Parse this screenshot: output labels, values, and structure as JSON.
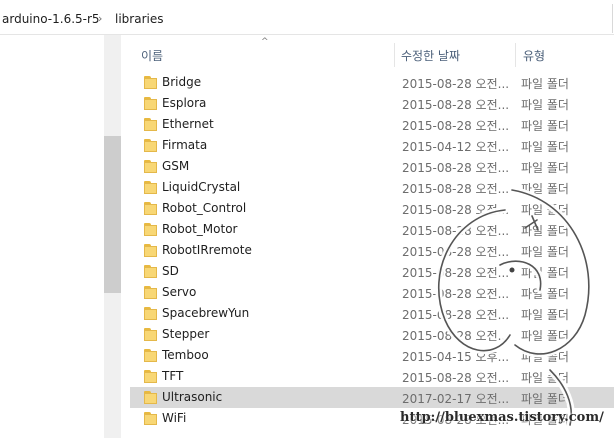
{
  "breadcrumb": {
    "parent": "arduino-1.6.5-r5",
    "separator": "›",
    "current": "libraries"
  },
  "columns": {
    "name": "이름",
    "date": "수정한 날짜",
    "type": "유형",
    "sort_indicator": "^"
  },
  "rows": [
    {
      "name": "Bridge",
      "date": "2015-08-28 오전...",
      "type": "파일 폴더",
      "icon": "folder-icon"
    },
    {
      "name": "Esplora",
      "date": "2015-08-28 오전...",
      "type": "파일 폴더",
      "icon": "folder-icon"
    },
    {
      "name": "Ethernet",
      "date": "2015-08-28 오전...",
      "type": "파일 폴더",
      "icon": "folder-icon"
    },
    {
      "name": "Firmata",
      "date": "2015-04-12 오전...",
      "type": "파일 폴더",
      "icon": "folder-icon"
    },
    {
      "name": "GSM",
      "date": "2015-08-28 오전...",
      "type": "파일 폴더",
      "icon": "folder-icon"
    },
    {
      "name": "LiquidCrystal",
      "date": "2015-08-28 오전...",
      "type": "파일 폴더",
      "icon": "folder-icon"
    },
    {
      "name": "Robot_Control",
      "date": "2015-08-28 오전...",
      "type": "파일 폴더",
      "icon": "folder-icon"
    },
    {
      "name": "Robot_Motor",
      "date": "2015-08-28 오전...",
      "type": "파일 폴더",
      "icon": "folder-icon"
    },
    {
      "name": "RobotIRremote",
      "date": "2015-08-28 오전...",
      "type": "파일 폴더",
      "icon": "folder-icon"
    },
    {
      "name": "SD",
      "date": "2015-08-28 오전...",
      "type": "파일 폴더",
      "icon": "folder-icon"
    },
    {
      "name": "Servo",
      "date": "2015-08-28 오전...",
      "type": "파일 폴더",
      "icon": "folder-icon"
    },
    {
      "name": "SpacebrewYun",
      "date": "2015-08-28 오전...",
      "type": "파일 폴더",
      "icon": "folder-icon"
    },
    {
      "name": "Stepper",
      "date": "2015-08-28 오전...",
      "type": "파일 폴더",
      "icon": "folder-icon"
    },
    {
      "name": "Temboo",
      "date": "2015-04-15 오후...",
      "type": "파일 폴더",
      "icon": "folder-icon"
    },
    {
      "name": "TFT",
      "date": "2015-08-28 오전...",
      "type": "파일 폴더",
      "icon": "folder-icon"
    },
    {
      "name": "Ultrasonic",
      "date": "2017-02-17 오전...",
      "type": "파일 폴더",
      "icon": "folder-icon",
      "selected": true
    },
    {
      "name": "WiFi",
      "date": "2015-08-28 오전...",
      "type": "파일 폴더",
      "icon": "folder-icon"
    }
  ],
  "watermark": {
    "url": "http://bluexmas.tistory.com/"
  },
  "colors": {
    "header_text": "#4c607a",
    "selected_row": "#d9d9d9",
    "folder": "#f8d775",
    "scroll_thumb": "#cdcdcd"
  }
}
